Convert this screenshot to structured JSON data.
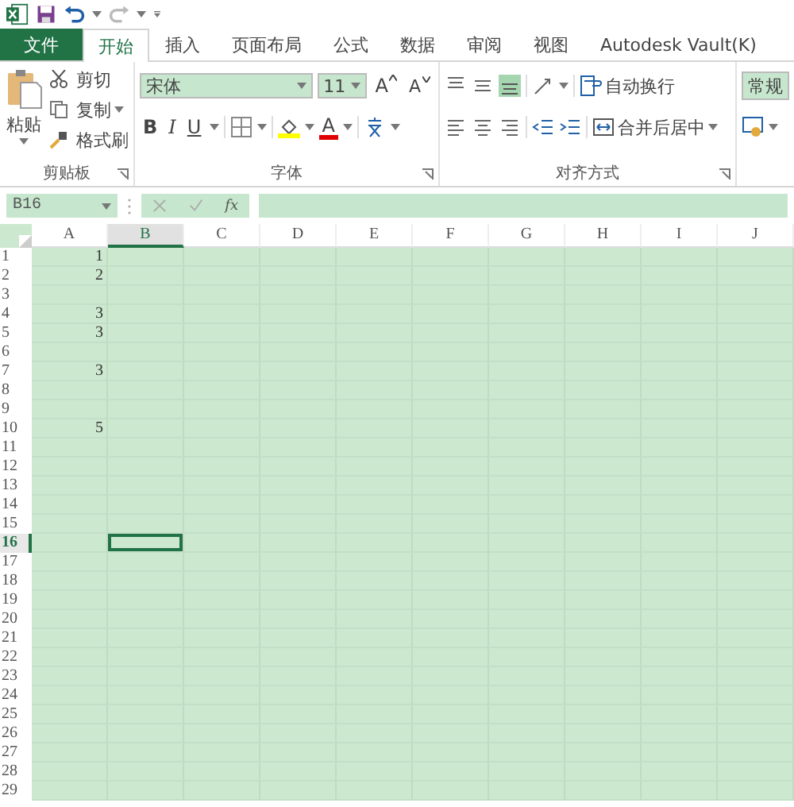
{
  "tabs": [
    {
      "label": "文件",
      "kind": "file",
      "selected": false
    },
    {
      "label": "开始",
      "kind": "tab",
      "selected": true
    },
    {
      "label": "插入",
      "kind": "tab",
      "selected": false
    },
    {
      "label": "页面布局",
      "kind": "tab",
      "selected": false
    },
    {
      "label": "公式",
      "kind": "tab",
      "selected": false
    },
    {
      "label": "数据",
      "kind": "tab",
      "selected": false
    },
    {
      "label": "审阅",
      "kind": "tab",
      "selected": false
    },
    {
      "label": "视图",
      "kind": "tab",
      "selected": false
    },
    {
      "label": "Autodesk Vault(K)",
      "kind": "tab",
      "selected": false
    }
  ],
  "clipboard": {
    "label": "剪贴板",
    "paste": "粘贴",
    "cut": "剪切",
    "copy": "复制",
    "format_painter": "格式刷"
  },
  "font": {
    "label": "字体",
    "font_name": "宋体",
    "font_size": "11",
    "grow": "A",
    "shrink": "A",
    "bold": "B",
    "italic": "I",
    "underline": "U",
    "font_color": "A"
  },
  "alignment": {
    "label": "对齐方式",
    "wrap_text": "自动换行",
    "merge_center": "合并后居中"
  },
  "number": {
    "format": "常规"
  },
  "formula_bar": {
    "name_box": "B16",
    "function": "fx"
  },
  "sheet": {
    "columns": [
      {
        "label": "A",
        "selected": false
      },
      {
        "label": "B",
        "selected": true
      },
      {
        "label": "C",
        "selected": false
      },
      {
        "label": "D",
        "selected": false
      },
      {
        "label": "E",
        "selected": false
      },
      {
        "label": "F",
        "selected": false
      },
      {
        "label": "G",
        "selected": false
      },
      {
        "label": "H",
        "selected": false
      },
      {
        "label": "I",
        "selected": false
      },
      {
        "label": "J",
        "selected": false
      }
    ],
    "rows": [
      {
        "label": "1",
        "selected": false,
        "cells": [
          "1"
        ]
      },
      {
        "label": "2",
        "selected": false,
        "cells": [
          "2"
        ]
      },
      {
        "label": "3",
        "selected": false
      },
      {
        "label": "4",
        "selected": false,
        "cells": [
          "3"
        ]
      },
      {
        "label": "5",
        "selected": false,
        "cells": [
          "3"
        ]
      },
      {
        "label": "6",
        "selected": false
      },
      {
        "label": "7",
        "selected": false,
        "cells": [
          "3"
        ]
      },
      {
        "label": "8",
        "selected": false
      },
      {
        "label": "9",
        "selected": false
      },
      {
        "label": "10",
        "selected": false,
        "cells": [
          "5"
        ]
      },
      {
        "label": "11",
        "selected": false
      },
      {
        "label": "12",
        "selected": false
      },
      {
        "label": "13",
        "selected": false
      },
      {
        "label": "14",
        "selected": false
      },
      {
        "label": "15",
        "selected": false
      },
      {
        "label": "16",
        "selected": true
      },
      {
        "label": "17",
        "selected": false
      },
      {
        "label": "18",
        "selected": false
      },
      {
        "label": "19",
        "selected": false
      },
      {
        "label": "20",
        "selected": false
      },
      {
        "label": "21",
        "selected": false
      },
      {
        "label": "22",
        "selected": false
      },
      {
        "label": "23",
        "selected": false
      },
      {
        "label": "24",
        "selected": false
      },
      {
        "label": "25",
        "selected": false
      },
      {
        "label": "26",
        "selected": false
      },
      {
        "label": "27",
        "selected": false
      },
      {
        "label": "28",
        "selected": false
      },
      {
        "label": "29",
        "selected": false
      }
    ]
  }
}
